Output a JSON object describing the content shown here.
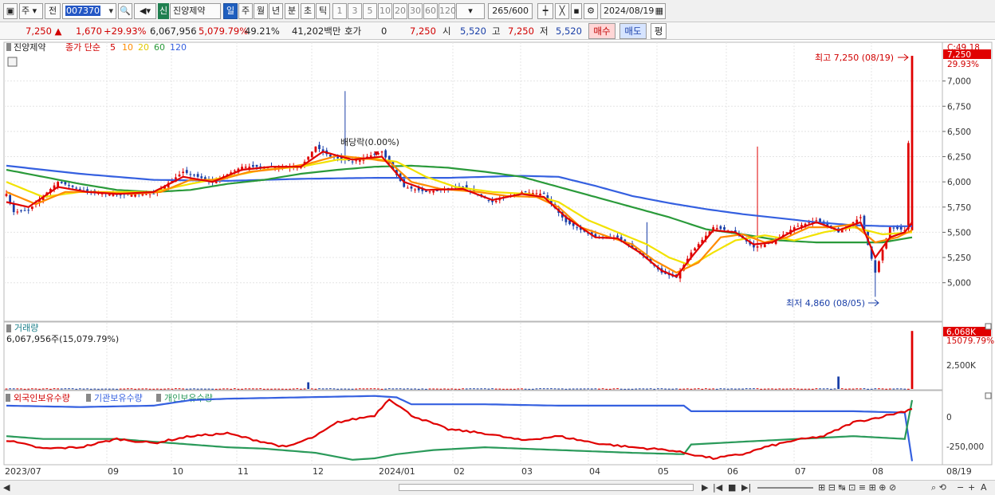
{
  "toolbar": {
    "market": "주",
    "prev_label": "전",
    "stock_code": "007370",
    "badge": "신",
    "stock_name": "진양제약",
    "periods": [
      "일",
      "주",
      "월",
      "년",
      "분",
      "초",
      "틱"
    ],
    "active_period": "일",
    "intervals": [
      "1",
      "3",
      "5",
      "10",
      "20",
      "30",
      "60",
      "120"
    ],
    "count": "265",
    "count_max": "/600",
    "date": "2024/08/19"
  },
  "quote": {
    "price": "7,250",
    "change": "1,670",
    "change_pct": "+29.93%",
    "volume": "6,067,956",
    "volume_pct": "5,079.79%",
    "turnover": "49.21%",
    "amount": "41,202백만",
    "hoga_label": "호가",
    "hoga_value": "0",
    "last": "7,250",
    "open_label": "시",
    "open": "5,520",
    "high_label": "고",
    "high": "7,250",
    "low_label": "저",
    "low": "5,520",
    "buy_label": "매수",
    "sell_label": "매도",
    "avg_label": "평"
  },
  "legend": {
    "name": "진양제약",
    "ma_title": "종가 단순",
    "ma_periods": [
      "5",
      "10",
      "20",
      "60",
      "120"
    ]
  },
  "annotations": {
    "high": "최고 7,250 (08/19)",
    "low": "최저 4,860 (08/05)",
    "dividend": "배당락(0.00%)"
  },
  "price_axis": {
    "top_label": "C:49.18",
    "last_label": "7,250",
    "pct_label": "29.93%",
    "ticks": [
      "7,000",
      "6,750",
      "6,500",
      "6,250",
      "6,000",
      "5,750",
      "5,500",
      "5,250",
      "5,000"
    ]
  },
  "volume_panel": {
    "title": "거래량",
    "value_text": "6,067,956주(15,079.79%)",
    "last_label": "6,068K",
    "pct_label": "15079.79%",
    "tick": "2,500K"
  },
  "holdings_panel": {
    "series_names": [
      "외국인보유수량",
      "기관보유수량",
      "개인보유수량"
    ],
    "ticks": [
      "0",
      "-250,000"
    ]
  },
  "x_axis": {
    "labels": [
      "2023/07",
      "09",
      "10",
      "11",
      "12",
      "2024/01",
      "02",
      "03",
      "04",
      "05",
      "06",
      "07",
      "08"
    ],
    "last_label": "08/19"
  },
  "colors": {
    "up": "#e00000",
    "down": "#1a3fa8",
    "ma5": "#e00000",
    "ma10": "#ff8c00",
    "ma20": "#f2e200",
    "ma60": "#2a9a3a",
    "ma120": "#3560e0",
    "foreign": "#e00000",
    "institution": "#3560e0",
    "individual": "#2a9a5a"
  },
  "chart_data": {
    "type": "candlestick",
    "x_start": "2023/07",
    "x_end": "08/19",
    "ylim": [
      4800,
      7250
    ],
    "high": 7250,
    "low": 4860,
    "last_close": 7250,
    "close_anchors": [
      [
        0,
        5880
      ],
      [
        2,
        5700
      ],
      [
        6,
        5720
      ],
      [
        14,
        6000
      ],
      [
        22,
        5900
      ],
      [
        30,
        5870
      ],
      [
        40,
        5880
      ],
      [
        48,
        6100
      ],
      [
        56,
        6000
      ],
      [
        64,
        6150
      ],
      [
        72,
        6150
      ],
      [
        80,
        6150
      ],
      [
        84,
        6350
      ],
      [
        88,
        6250
      ],
      [
        94,
        6200
      ],
      [
        102,
        6300
      ],
      [
        108,
        5950
      ],
      [
        114,
        5900
      ],
      [
        124,
        5950
      ],
      [
        132,
        5800
      ],
      [
        140,
        5900
      ],
      [
        146,
        5880
      ],
      [
        152,
        5600
      ],
      [
        160,
        5450
      ],
      [
        166,
        5450
      ],
      [
        172,
        5300
      ],
      [
        178,
        5100
      ],
      [
        182,
        5050
      ],
      [
        186,
        5300
      ],
      [
        192,
        5550
      ],
      [
        198,
        5500
      ],
      [
        203,
        5350
      ],
      [
        208,
        5400
      ],
      [
        214,
        5550
      ],
      [
        220,
        5620
      ],
      [
        226,
        5500
      ],
      [
        232,
        5650
      ],
      [
        236,
        5100
      ],
      [
        240,
        5550
      ],
      [
        244,
        5520
      ],
      [
        246,
        7250
      ]
    ],
    "ma5_anchors": [
      [
        0,
        5800
      ],
      [
        6,
        5750
      ],
      [
        14,
        5950
      ],
      [
        22,
        5900
      ],
      [
        30,
        5880
      ],
      [
        40,
        5900
      ],
      [
        48,
        6050
      ],
      [
        56,
        6000
      ],
      [
        64,
        6120
      ],
      [
        72,
        6150
      ],
      [
        80,
        6150
      ],
      [
        86,
        6300
      ],
      [
        94,
        6220
      ],
      [
        102,
        6250
      ],
      [
        108,
        6000
      ],
      [
        114,
        5920
      ],
      [
        124,
        5930
      ],
      [
        132,
        5820
      ],
      [
        140,
        5880
      ],
      [
        146,
        5850
      ],
      [
        152,
        5650
      ],
      [
        160,
        5450
      ],
      [
        166,
        5440
      ],
      [
        172,
        5300
      ],
      [
        178,
        5120
      ],
      [
        182,
        5060
      ],
      [
        186,
        5250
      ],
      [
        192,
        5520
      ],
      [
        198,
        5500
      ],
      [
        203,
        5380
      ],
      [
        208,
        5400
      ],
      [
        214,
        5520
      ],
      [
        220,
        5600
      ],
      [
        226,
        5520
      ],
      [
        232,
        5600
      ],
      [
        236,
        5250
      ],
      [
        240,
        5450
      ],
      [
        244,
        5500
      ],
      [
        246,
        5600
      ]
    ],
    "ma10_anchors": [
      [
        0,
        5900
      ],
      [
        8,
        5780
      ],
      [
        16,
        5900
      ],
      [
        24,
        5900
      ],
      [
        34,
        5880
      ],
      [
        42,
        5900
      ],
      [
        50,
        6020
      ],
      [
        58,
        6020
      ],
      [
        66,
        6100
      ],
      [
        74,
        6130
      ],
      [
        82,
        6180
      ],
      [
        90,
        6260
      ],
      [
        98,
        6230
      ],
      [
        104,
        6200
      ],
      [
        110,
        6000
      ],
      [
        118,
        5930
      ],
      [
        128,
        5900
      ],
      [
        136,
        5860
      ],
      [
        144,
        5850
      ],
      [
        150,
        5750
      ],
      [
        156,
        5550
      ],
      [
        164,
        5450
      ],
      [
        170,
        5380
      ],
      [
        176,
        5220
      ],
      [
        182,
        5100
      ],
      [
        188,
        5200
      ],
      [
        194,
        5450
      ],
      [
        200,
        5480
      ],
      [
        206,
        5400
      ],
      [
        212,
        5450
      ],
      [
        218,
        5550
      ],
      [
        224,
        5550
      ],
      [
        230,
        5580
      ],
      [
        236,
        5400
      ],
      [
        242,
        5450
      ],
      [
        246,
        5520
      ]
    ],
    "ma20_anchors": [
      [
        0,
        6000
      ],
      [
        10,
        5850
      ],
      [
        20,
        5900
      ],
      [
        30,
        5900
      ],
      [
        40,
        5900
      ],
      [
        50,
        5980
      ],
      [
        60,
        6050
      ],
      [
        70,
        6120
      ],
      [
        80,
        6150
      ],
      [
        90,
        6220
      ],
      [
        100,
        6230
      ],
      [
        106,
        6200
      ],
      [
        114,
        6050
      ],
      [
        122,
        5950
      ],
      [
        132,
        5900
      ],
      [
        142,
        5880
      ],
      [
        150,
        5800
      ],
      [
        158,
        5620
      ],
      [
        166,
        5500
      ],
      [
        174,
        5380
      ],
      [
        180,
        5250
      ],
      [
        186,
        5170
      ],
      [
        192,
        5300
      ],
      [
        198,
        5420
      ],
      [
        206,
        5470
      ],
      [
        214,
        5420
      ],
      [
        222,
        5500
      ],
      [
        230,
        5550
      ],
      [
        238,
        5480
      ],
      [
        246,
        5500
      ]
    ],
    "ma60_anchors": [
      [
        0,
        6120
      ],
      [
        10,
        6050
      ],
      [
        20,
        5980
      ],
      [
        30,
        5920
      ],
      [
        40,
        5900
      ],
      [
        50,
        5920
      ],
      [
        60,
        5980
      ],
      [
        70,
        6020
      ],
      [
        80,
        6080
      ],
      [
        90,
        6120
      ],
      [
        100,
        6150
      ],
      [
        110,
        6160
      ],
      [
        120,
        6140
      ],
      [
        130,
        6100
      ],
      [
        140,
        6050
      ],
      [
        150,
        5950
      ],
      [
        160,
        5850
      ],
      [
        170,
        5750
      ],
      [
        180,
        5650
      ],
      [
        190,
        5530
      ],
      [
        200,
        5480
      ],
      [
        210,
        5420
      ],
      [
        220,
        5400
      ],
      [
        230,
        5400
      ],
      [
        238,
        5400
      ],
      [
        246,
        5450
      ]
    ],
    "ma120_anchors": [
      [
        0,
        6160
      ],
      [
        20,
        6080
      ],
      [
        40,
        6020
      ],
      [
        60,
        6010
      ],
      [
        80,
        6030
      ],
      [
        100,
        6040
      ],
      [
        120,
        6040
      ],
      [
        140,
        6060
      ],
      [
        150,
        6050
      ],
      [
        160,
        5960
      ],
      [
        170,
        5860
      ],
      [
        180,
        5790
      ],
      [
        190,
        5730
      ],
      [
        200,
        5680
      ],
      [
        210,
        5640
      ],
      [
        220,
        5600
      ],
      [
        230,
        5570
      ],
      [
        240,
        5560
      ],
      [
        246,
        5560
      ]
    ],
    "volume": {
      "ylim": [
        0,
        6500000
      ],
      "last": 6067956,
      "spikes": [
        [
          82,
          700000
        ],
        [
          226,
          1300000
        ],
        [
          246,
          6067956
        ]
      ]
    },
    "holdings": {
      "ylim": [
        -400000,
        100000
      ],
      "foreign_anchors": [
        [
          0,
          -230000
        ],
        [
          10,
          -290000
        ],
        [
          20,
          -280000
        ],
        [
          30,
          -220000
        ],
        [
          40,
          -250000
        ],
        [
          50,
          -200000
        ],
        [
          60,
          -180000
        ],
        [
          68,
          -230000
        ],
        [
          76,
          -280000
        ],
        [
          84,
          -200000
        ],
        [
          90,
          -100000
        ],
        [
          100,
          -50000
        ],
        [
          104,
          70000
        ],
        [
          110,
          -50000
        ],
        [
          120,
          -150000
        ],
        [
          130,
          -180000
        ],
        [
          140,
          -230000
        ],
        [
          150,
          -200000
        ],
        [
          160,
          -250000
        ],
        [
          170,
          -280000
        ],
        [
          180,
          -300000
        ],
        [
          186,
          -330000
        ],
        [
          192,
          -360000
        ],
        [
          200,
          -330000
        ],
        [
          206,
          -280000
        ],
        [
          214,
          -230000
        ],
        [
          222,
          -200000
        ],
        [
          230,
          -100000
        ],
        [
          236,
          -70000
        ],
        [
          244,
          -20000
        ],
        [
          246,
          0
        ]
      ],
      "institution_anchors": [
        [
          0,
          20000
        ],
        [
          20,
          10000
        ],
        [
          40,
          20000
        ],
        [
          50,
          60000
        ],
        [
          60,
          70000
        ],
        [
          80,
          80000
        ],
        [
          100,
          90000
        ],
        [
          106,
          80000
        ],
        [
          110,
          30000
        ],
        [
          130,
          30000
        ],
        [
          150,
          20000
        ],
        [
          170,
          20000
        ],
        [
          184,
          20000
        ],
        [
          186,
          -20000
        ],
        [
          200,
          -20000
        ],
        [
          230,
          -20000
        ],
        [
          244,
          -30000
        ],
        [
          246,
          -380000
        ]
      ],
      "individual_anchors": [
        [
          0,
          -200000
        ],
        [
          10,
          -220000
        ],
        [
          30,
          -220000
        ],
        [
          50,
          -260000
        ],
        [
          60,
          -280000
        ],
        [
          70,
          -290000
        ],
        [
          84,
          -320000
        ],
        [
          94,
          -370000
        ],
        [
          100,
          -360000
        ],
        [
          106,
          -330000
        ],
        [
          116,
          -300000
        ],
        [
          130,
          -280000
        ],
        [
          150,
          -300000
        ],
        [
          170,
          -320000
        ],
        [
          184,
          -330000
        ],
        [
          186,
          -260000
        ],
        [
          200,
          -240000
        ],
        [
          230,
          -200000
        ],
        [
          244,
          -220000
        ],
        [
          246,
          60000
        ]
      ]
    }
  }
}
